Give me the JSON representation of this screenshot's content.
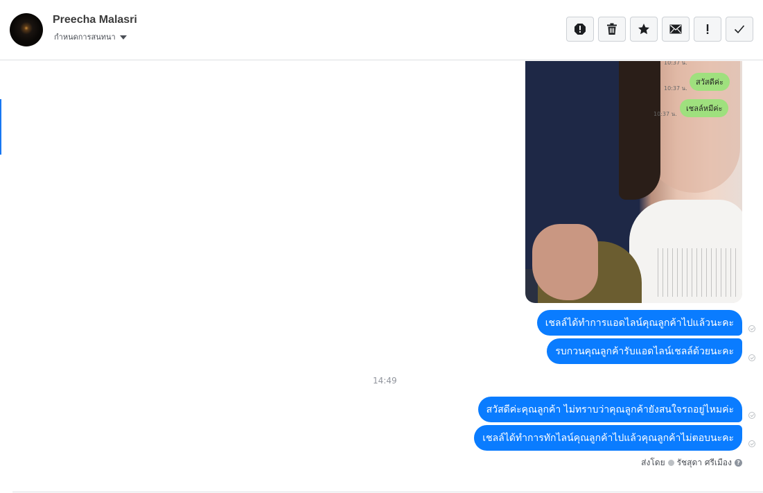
{
  "header": {
    "contact_name": "Preecha Malasri",
    "sub_action": "กำหนดการสนทนา",
    "toolbar": [
      {
        "icon": "report-icon",
        "name": "report-button"
      },
      {
        "icon": "trash-icon",
        "name": "delete-button"
      },
      {
        "icon": "star-icon",
        "name": "star-button"
      },
      {
        "icon": "mail-icon",
        "name": "mark-unread-button"
      },
      {
        "icon": "exclamation-icon",
        "name": "spam-button"
      },
      {
        "icon": "check-icon",
        "name": "done-button"
      }
    ]
  },
  "photo": {
    "overlay_times": [
      "10:37 น.",
      "10:37 น.",
      "10:37 น."
    ],
    "overlay_messages": [
      "สวัสดีค่ะ",
      "เชลล์หมีค่ะ"
    ]
  },
  "messages": [
    {
      "text": "เชลล์ได้ทำการแอดไลน์คุณลูกค้าไปแล้วนะคะ"
    },
    {
      "text": "รบกวนคุณลูกค้ารับแอดไลน์เชลล์ด้วยนะคะ"
    },
    {
      "text": "สวัสดีค่ะคุณลูกค้า ไม่ทราบว่าคุณลูกค้ายังสนใจรถอยู่ไหมค่ะ"
    },
    {
      "text": "เชลล์ได้ทำการทักไลน์คุณลูกค้าไปแล้วคุณลูกค้าไม่ตอบนะคะ"
    }
  ],
  "timestamp": "14:49",
  "sent_by": {
    "label": "ส่งโดย",
    "name": "รัชสุดา ศรีเมือง",
    "help": "?"
  },
  "colors": {
    "bubble": "#0a7cff",
    "line_bubble": "#9fe07e",
    "accent": "#1877f2"
  }
}
